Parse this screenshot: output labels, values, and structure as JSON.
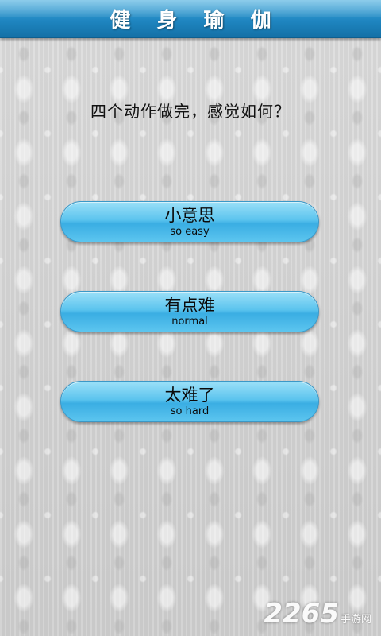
{
  "header": {
    "title": "健 身 瑜 伽"
  },
  "question": "四个动作做完，感觉如何？",
  "answers": [
    {
      "label_cn": "小意思",
      "label_en": "so easy"
    },
    {
      "label_cn": "有点难",
      "label_en": "normal"
    },
    {
      "label_cn": "太难了",
      "label_en": "so hard"
    }
  ],
  "watermark": {
    "number": "2265",
    "text": "手游网"
  },
  "colors": {
    "header": "#1f86c1",
    "button": "#5cc4ee"
  }
}
